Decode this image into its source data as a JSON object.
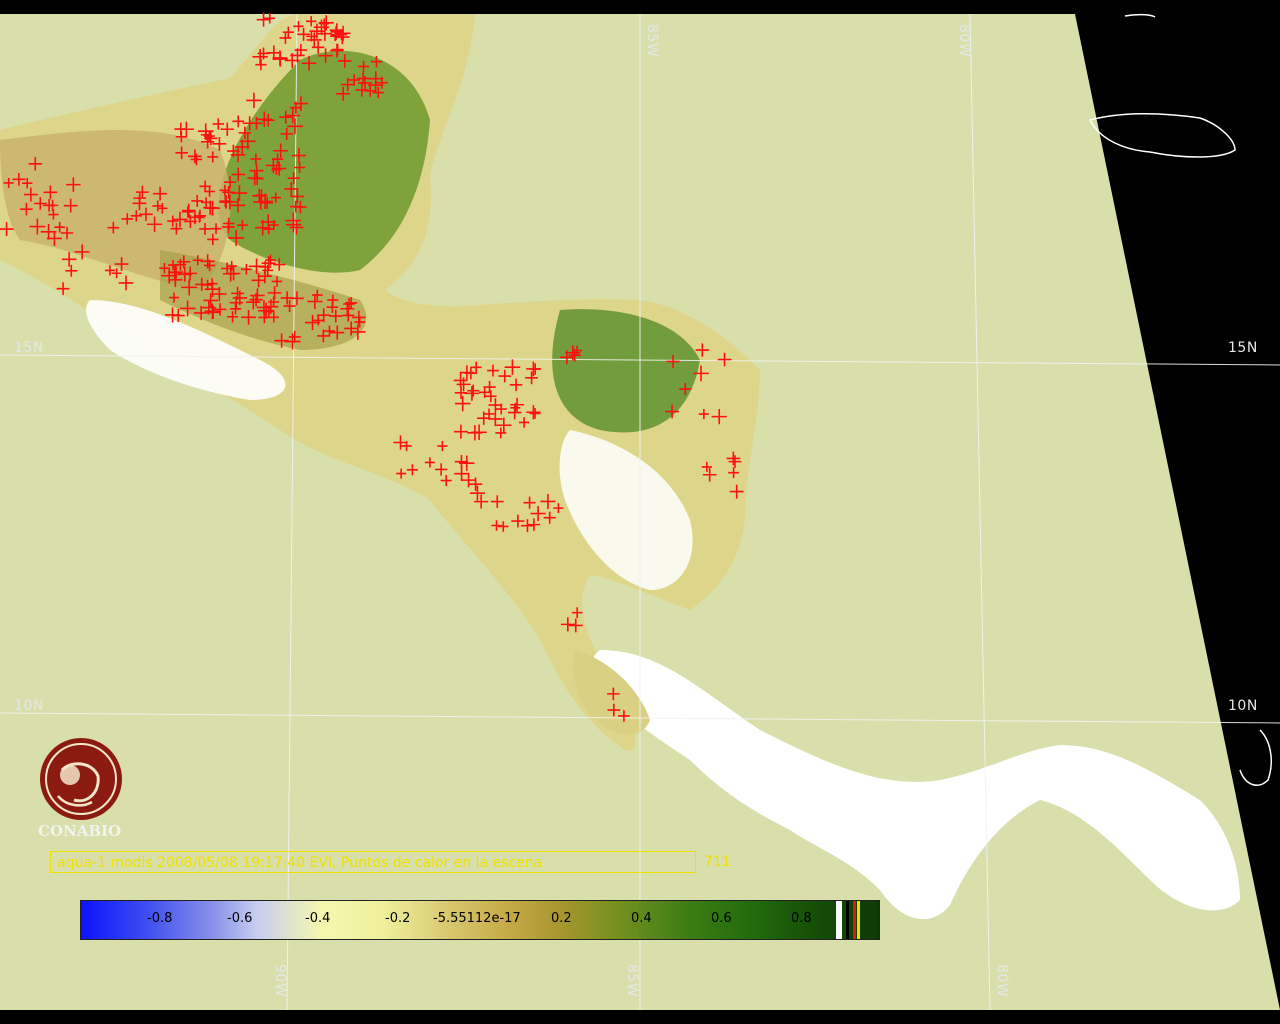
{
  "map": {
    "ocean_color": "#d9dfab",
    "outside_color": "#000000",
    "fire_marker_color": "#ff1010",
    "coastline_color": "#ffffff",
    "grid_color": "#f2f2f2"
  },
  "grid_labels": {
    "lon_85w_top": "85W",
    "lon_80w_top": "80W",
    "lon_90w_bottom": "90W",
    "lon_85w_bottom": "85W",
    "lon_80w_bottom": "80W",
    "lat_15n_left": "15N",
    "lat_15n_right": "15N",
    "lat_10n_left": "10N",
    "lat_10n_right": "10N"
  },
  "logo": {
    "text": "CONABIO",
    "color": "#8b1a10"
  },
  "caption": {
    "text": "aqua-1 modis 2008/05/08 19:17:40 EVI, Puntos de calor en la escena",
    "count": "711"
  },
  "colorbar": {
    "ticks": [
      "-0.8",
      "-0.6",
      "-0.4",
      "-0.2",
      "-5.55112e-17",
      "0.2",
      "0.4",
      "0.6",
      "0.8"
    ]
  }
}
